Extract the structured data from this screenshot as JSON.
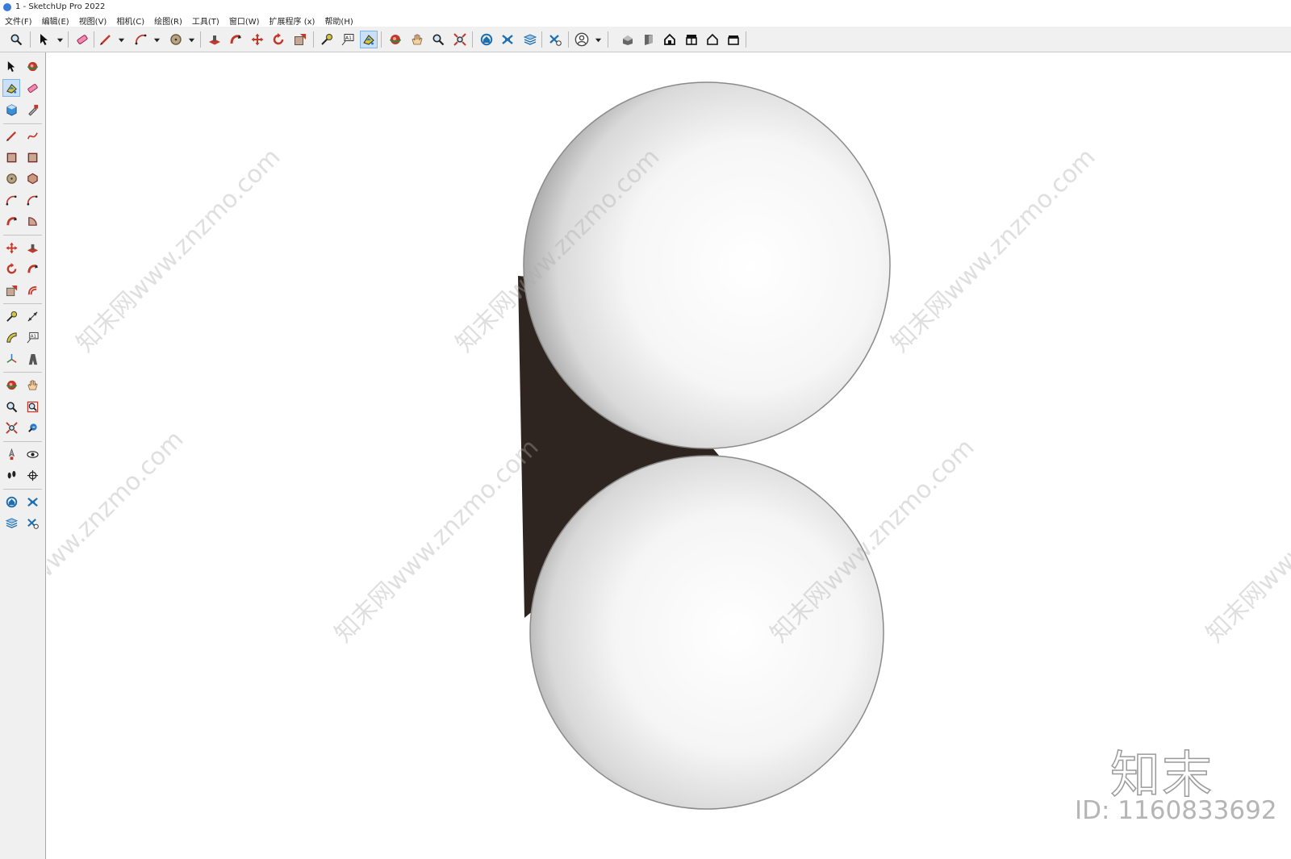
{
  "window": {
    "title": "1 - SketchUp Pro 2022"
  },
  "menu": [
    "文件(F)",
    "编辑(E)",
    "视图(V)",
    "相机(C)",
    "绘图(R)",
    "工具(T)",
    "窗口(W)",
    "扩展程序 (x)",
    "帮助(H)"
  ],
  "watermark": {
    "text": "知末网www.znzmo.com",
    "brand": "知末",
    "id_text": "ID: 1160833692"
  },
  "colors": {
    "bracket": "#2f2520",
    "sphere_edge": "#8a8a8a",
    "accent": "#c9e0f7"
  }
}
